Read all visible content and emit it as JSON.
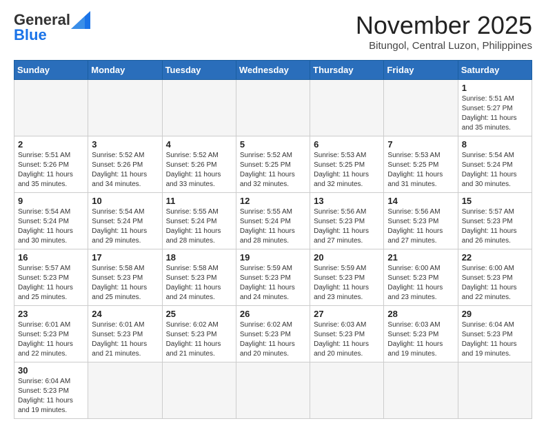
{
  "header": {
    "logo_general": "General",
    "logo_blue": "Blue",
    "main_title": "November 2025",
    "subtitle": "Bitungol, Central Luzon, Philippines"
  },
  "days_of_week": [
    "Sunday",
    "Monday",
    "Tuesday",
    "Wednesday",
    "Thursday",
    "Friday",
    "Saturday"
  ],
  "weeks": [
    [
      {
        "day": "",
        "info": ""
      },
      {
        "day": "",
        "info": ""
      },
      {
        "day": "",
        "info": ""
      },
      {
        "day": "",
        "info": ""
      },
      {
        "day": "",
        "info": ""
      },
      {
        "day": "",
        "info": ""
      },
      {
        "day": "1",
        "info": "Sunrise: 5:51 AM\nSunset: 5:27 PM\nDaylight: 11 hours and 35 minutes."
      }
    ],
    [
      {
        "day": "2",
        "info": "Sunrise: 5:51 AM\nSunset: 5:26 PM\nDaylight: 11 hours and 35 minutes."
      },
      {
        "day": "3",
        "info": "Sunrise: 5:52 AM\nSunset: 5:26 PM\nDaylight: 11 hours and 34 minutes."
      },
      {
        "day": "4",
        "info": "Sunrise: 5:52 AM\nSunset: 5:26 PM\nDaylight: 11 hours and 33 minutes."
      },
      {
        "day": "5",
        "info": "Sunrise: 5:52 AM\nSunset: 5:25 PM\nDaylight: 11 hours and 32 minutes."
      },
      {
        "day": "6",
        "info": "Sunrise: 5:53 AM\nSunset: 5:25 PM\nDaylight: 11 hours and 32 minutes."
      },
      {
        "day": "7",
        "info": "Sunrise: 5:53 AM\nSunset: 5:25 PM\nDaylight: 11 hours and 31 minutes."
      },
      {
        "day": "8",
        "info": "Sunrise: 5:54 AM\nSunset: 5:24 PM\nDaylight: 11 hours and 30 minutes."
      }
    ],
    [
      {
        "day": "9",
        "info": "Sunrise: 5:54 AM\nSunset: 5:24 PM\nDaylight: 11 hours and 30 minutes."
      },
      {
        "day": "10",
        "info": "Sunrise: 5:54 AM\nSunset: 5:24 PM\nDaylight: 11 hours and 29 minutes."
      },
      {
        "day": "11",
        "info": "Sunrise: 5:55 AM\nSunset: 5:24 PM\nDaylight: 11 hours and 28 minutes."
      },
      {
        "day": "12",
        "info": "Sunrise: 5:55 AM\nSunset: 5:24 PM\nDaylight: 11 hours and 28 minutes."
      },
      {
        "day": "13",
        "info": "Sunrise: 5:56 AM\nSunset: 5:23 PM\nDaylight: 11 hours and 27 minutes."
      },
      {
        "day": "14",
        "info": "Sunrise: 5:56 AM\nSunset: 5:23 PM\nDaylight: 11 hours and 27 minutes."
      },
      {
        "day": "15",
        "info": "Sunrise: 5:57 AM\nSunset: 5:23 PM\nDaylight: 11 hours and 26 minutes."
      }
    ],
    [
      {
        "day": "16",
        "info": "Sunrise: 5:57 AM\nSunset: 5:23 PM\nDaylight: 11 hours and 25 minutes."
      },
      {
        "day": "17",
        "info": "Sunrise: 5:58 AM\nSunset: 5:23 PM\nDaylight: 11 hours and 25 minutes."
      },
      {
        "day": "18",
        "info": "Sunrise: 5:58 AM\nSunset: 5:23 PM\nDaylight: 11 hours and 24 minutes."
      },
      {
        "day": "19",
        "info": "Sunrise: 5:59 AM\nSunset: 5:23 PM\nDaylight: 11 hours and 24 minutes."
      },
      {
        "day": "20",
        "info": "Sunrise: 5:59 AM\nSunset: 5:23 PM\nDaylight: 11 hours and 23 minutes."
      },
      {
        "day": "21",
        "info": "Sunrise: 6:00 AM\nSunset: 5:23 PM\nDaylight: 11 hours and 23 minutes."
      },
      {
        "day": "22",
        "info": "Sunrise: 6:00 AM\nSunset: 5:23 PM\nDaylight: 11 hours and 22 minutes."
      }
    ],
    [
      {
        "day": "23",
        "info": "Sunrise: 6:01 AM\nSunset: 5:23 PM\nDaylight: 11 hours and 22 minutes."
      },
      {
        "day": "24",
        "info": "Sunrise: 6:01 AM\nSunset: 5:23 PM\nDaylight: 11 hours and 21 minutes."
      },
      {
        "day": "25",
        "info": "Sunrise: 6:02 AM\nSunset: 5:23 PM\nDaylight: 11 hours and 21 minutes."
      },
      {
        "day": "26",
        "info": "Sunrise: 6:02 AM\nSunset: 5:23 PM\nDaylight: 11 hours and 20 minutes."
      },
      {
        "day": "27",
        "info": "Sunrise: 6:03 AM\nSunset: 5:23 PM\nDaylight: 11 hours and 20 minutes."
      },
      {
        "day": "28",
        "info": "Sunrise: 6:03 AM\nSunset: 5:23 PM\nDaylight: 11 hours and 19 minutes."
      },
      {
        "day": "29",
        "info": "Sunrise: 6:04 AM\nSunset: 5:23 PM\nDaylight: 11 hours and 19 minutes."
      }
    ],
    [
      {
        "day": "30",
        "info": "Sunrise: 6:04 AM\nSunset: 5:23 PM\nDaylight: 11 hours and 19 minutes."
      },
      {
        "day": "",
        "info": ""
      },
      {
        "day": "",
        "info": ""
      },
      {
        "day": "",
        "info": ""
      },
      {
        "day": "",
        "info": ""
      },
      {
        "day": "",
        "info": ""
      },
      {
        "day": "",
        "info": ""
      }
    ]
  ]
}
